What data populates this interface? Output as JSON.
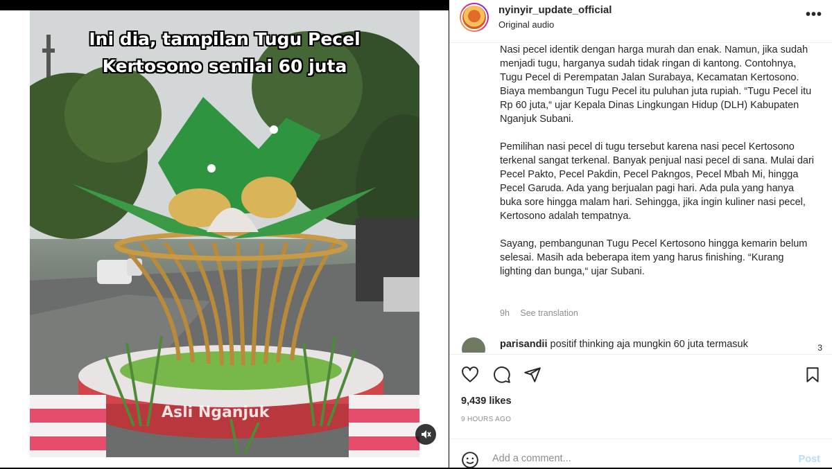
{
  "video": {
    "caption_line1": "Ini dia, tampilan Tugu Pecel",
    "caption_line2": "Kertosono senilai 60 juta",
    "watermark": "Asli Nganjuk",
    "mute_icon": "speaker-muted-icon"
  },
  "post": {
    "username": "nyinyir_update_official",
    "audio": "Original audio",
    "more_icon": "more-horizontal-icon",
    "paragraphs": [
      "Nasi pecel identik dengan harga murah dan enak. Namun, jika sudah menjadi tugu, harganya sudah tidak ringan di kantong. Contohnya, Tugu Pecel di Perempatan Jalan Surabaya, Kecamatan Kertosono. Biaya membangun Tugu Pecel itu puluhan juta rupiah. “Tugu Pecel itu Rp 60 juta,“ ujar Kepala Dinas Lingkungan Hidup (DLH) Kabupaten Nganjuk Subani.",
      "Pemilihan nasi pecel di tugu tersebut karena nasi pecel Kertosono terkenal sangat terkenal. Banyak penjual nasi pecel di sana. Mulai dari Pecel Pakto, Pecel Pakdin, Pecel Pakngos, Pecel Mbah Mi, hingga Pecel Garuda. Ada yang berjualan pagi hari. Ada pula yang hanya buka sore hingga malam hari. Sehingga, jika ingin kuliner nasi pecel, Kertosono adalah tempatnya.",
      "Sayang, pembangunan Tugu Pecel Kertosono hingga kemarin belum selesai. Masih ada beberapa item yang harus finishing. “Kurang lighting dan bunga,“ ujar Subani."
    ],
    "age": "9h",
    "see_translation": "See translation"
  },
  "comment": {
    "username": "parisandii",
    "text": "positif thinking aja mungkin 60 juta termasuk",
    "reply": "3"
  },
  "actions": {
    "like_icon": "heart-icon",
    "comment_icon": "comment-icon",
    "share_icon": "paper-plane-icon",
    "save_icon": "bookmark-icon",
    "likes": "9,439 likes",
    "time": "9 HOURS AGO"
  },
  "add_comment": {
    "emoji_icon": "smiley-icon",
    "placeholder": "Add a comment...",
    "post_label": "Post"
  }
}
